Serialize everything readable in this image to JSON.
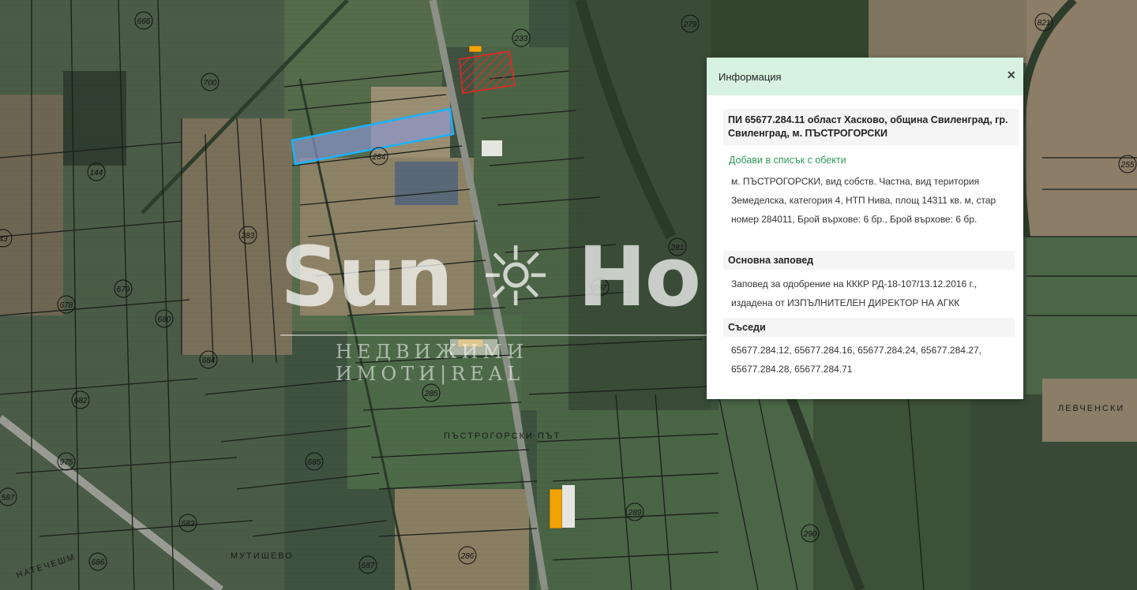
{
  "map": {
    "parcel_labels": [
      "666",
      "700",
      "279",
      "821",
      "144",
      "283",
      "284",
      "233",
      "255",
      "683",
      "679",
      "678",
      "680",
      "684",
      "682",
      "975",
      "685",
      "686",
      "285",
      "281",
      "287",
      "289",
      "290",
      "286",
      "43",
      "687",
      "587"
    ],
    "place_labels": [
      "ПЪСТРОГОРСКИ ПЪТ",
      "ЛЕВЧЕНСКИ",
      "МУТИШЕВО",
      "НАТЕЧЕШМ"
    ]
  },
  "watermark": {
    "brand": "Sun ☼ Ho",
    "tagline": "НЕДВИЖИМИ ИМОТИ|REAL"
  },
  "info_panel": {
    "title": "Информация",
    "close_glyph": "×",
    "parcel_header": "ПИ 65677.284.11 област Хасково, община Свиленград, гр. Свиленград, м. ПЪСТРОГОРСКИ",
    "add_link": "Добави в списък с обекти",
    "details": "м. ПЪСТРОГОРСКИ, вид собств. Частна, вид територия Земеделска, категория 4, НТП Нива, площ 14311 кв. м, стар номер 284011, Брой върхове: 6 бр., Брой върхове: 6 бр.",
    "order_header": "Основна заповед",
    "order_text": "Заповед за одобрение на КККР РД-18-107/13.12.2016 г., издадена от ИЗПЪЛНИТЕЛЕН ДИРЕКТОР НА АГКК",
    "neighbors_header": "Съседи",
    "neighbors_text": "65677.284.12, 65677.284.16, 65677.284.24, 65677.284.27, 65677.284.28, 65677.284.71"
  }
}
